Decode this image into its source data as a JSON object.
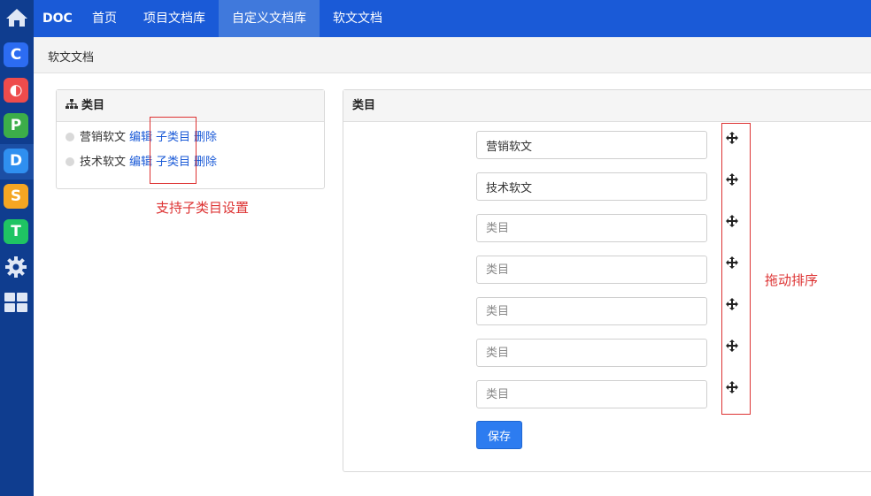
{
  "rail": {
    "items": [
      {
        "icon": "home-icon",
        "letter": "",
        "color": "#0f3d8f"
      },
      {
        "icon": "c-app-icon",
        "letter": "C",
        "color": "#2c6cf2"
      },
      {
        "icon": "o-app-icon",
        "letter": "◐",
        "color": "#ee4c4c"
      },
      {
        "icon": "p-app-icon",
        "letter": "P",
        "color": "#3cae49"
      },
      {
        "icon": "d-app-icon",
        "letter": "D",
        "color": "#2f8ff0"
      },
      {
        "icon": "s-app-icon",
        "letter": "S",
        "color": "#f5a623"
      },
      {
        "icon": "t-app-icon",
        "letter": "T",
        "color": "#1fc463"
      },
      {
        "icon": "gear-icon",
        "letter": "",
        "color": "#0f3d8f"
      },
      {
        "icon": "grid-icon",
        "letter": "",
        "color": "#0f3d8f"
      }
    ]
  },
  "topnav": {
    "brand": "DOC",
    "items": [
      "首页",
      "项目文档库",
      "自定义文档库",
      "软文文档"
    ],
    "active_index": 2
  },
  "breadcrumb": "软文文档",
  "left_panel": {
    "title": "类目",
    "categories": [
      {
        "name": "营销软文",
        "edit": "编辑",
        "sub": "子类目",
        "delete": "删除"
      },
      {
        "name": "技术软文",
        "edit": "编辑",
        "sub": "子类目",
        "delete": "删除"
      }
    ]
  },
  "right_panel": {
    "title": "类目",
    "fields": [
      {
        "value": "营销软文",
        "placeholder": "类目"
      },
      {
        "value": "技术软文",
        "placeholder": "类目"
      },
      {
        "value": "",
        "placeholder": "类目"
      },
      {
        "value": "",
        "placeholder": "类目"
      },
      {
        "value": "",
        "placeholder": "类目"
      },
      {
        "value": "",
        "placeholder": "类目"
      },
      {
        "value": "",
        "placeholder": "类目"
      }
    ],
    "save_label": "保存"
  },
  "annotations": {
    "subcategory_note": "支持子类目设置",
    "drag_note": "拖动排序",
    "color": "#d33333"
  }
}
